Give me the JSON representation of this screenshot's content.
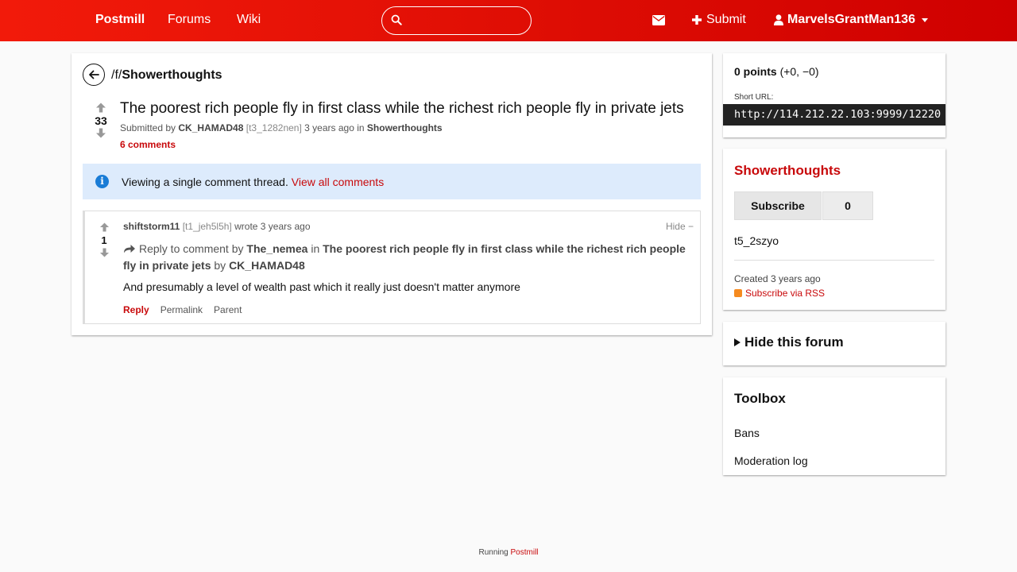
{
  "header": {
    "brand": "Postmill",
    "nav": [
      "Forums",
      "Wiki"
    ],
    "search_value": "",
    "submit_label": "Submit",
    "username": "MarvelsGrantMan136"
  },
  "crumb": {
    "prefix": "/f/",
    "forum": "Showerthoughts"
  },
  "submission": {
    "score": "33",
    "title": "The poorest rich people fly in first class while the richest rich people fly in private jets",
    "submitted_by_label": "Submitted by",
    "author": "CK_HAMAD48",
    "id": "[t3_1282nen]",
    "time": "3 years ago",
    "in_label": "in",
    "forum": "Showerthoughts",
    "comments_link": "6 comments"
  },
  "alert": {
    "message": "Viewing a single comment thread.",
    "link": "View all comments"
  },
  "comment": {
    "score": "1",
    "author": "shiftstorm11",
    "id": "[t1_jeh5l5h]",
    "wrote": "wrote 3 years ago",
    "hide": "Hide −",
    "reply_prefix": "Reply to comment by",
    "reply_to": "The_nemea",
    "in_label": "in",
    "thread_title": "The poorest rich people fly in first class while the richest rich people fly in private jets",
    "by_label": "by",
    "thread_author": "CK_HAMAD48",
    "body": "And presumably a level of wealth past which it really just doesn't matter anymore",
    "actions": {
      "reply": "Reply",
      "permalink": "Permalink",
      "parent": "Parent"
    }
  },
  "sidebar": {
    "points_bold": "0 points",
    "points_detail": "(+0, −0)",
    "short_url_label": "Short URL:",
    "short_url": "http://114.212.22.103:9999/12220",
    "forum_name": "Showerthoughts",
    "subscribe": "Subscribe",
    "subscriber_count": "0",
    "forum_id": "t5_2szyo",
    "created": "Created 3 years ago",
    "rss": "Subscribe via RSS",
    "hide_forum": "Hide this forum",
    "toolbox_title": "Toolbox",
    "toolbox_links": [
      "Bans",
      "Moderation log"
    ]
  },
  "footer": {
    "prefix": "Running",
    "link": "Postmill"
  },
  "colors": {
    "accent": "#c8090b",
    "header": "#e00b04",
    "alert_bg": "#ddebfc",
    "info_icon": "#1a7cd6"
  }
}
